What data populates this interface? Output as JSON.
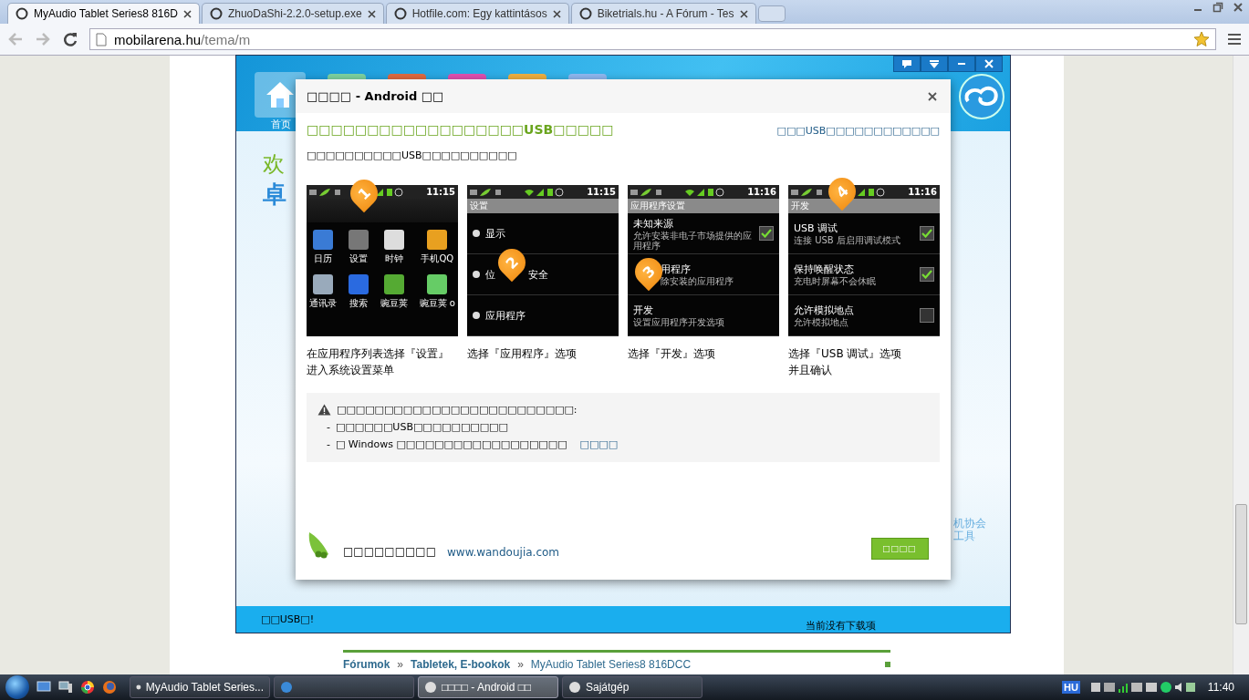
{
  "browser": {
    "tabs": [
      {
        "title": "MyAudio Tablet Series8 816D",
        "selected": true
      },
      {
        "title": "ZhuoDaShi-2.2.0-setup.exe",
        "selected": false
      },
      {
        "title": "Hotfile.com: Egy kattintásos",
        "selected": false
      },
      {
        "title": "Biketrials.hu - A Fórum - Tes",
        "selected": false
      }
    ],
    "address": {
      "host": "mobilarena.hu",
      "path": "/tema/m"
    }
  },
  "page": {
    "breadcrumb": [
      {
        "label": "Fórumok",
        "kind": "link"
      },
      {
        "label": "»",
        "kind": "sep"
      },
      {
        "label": "Tabletek, E-bookok",
        "kind": "link"
      },
      {
        "label": "»",
        "kind": "sep"
      },
      {
        "label": "MyAudio Tablet Series8 816DCC",
        "kind": "current"
      }
    ]
  },
  "app": {
    "home_label": "首页",
    "welcome": "欢",
    "welcome_sub": "卓",
    "side_lines": [
      "机协会",
      "工具"
    ],
    "status_left": "□□USB□!",
    "status_right": "当前没有下载项"
  },
  "dialog": {
    "title": "□□□□ - Android □□",
    "headline": "□□□□□□□□□□□□□□□□□□USB□□□□□",
    "help_link": "□□□USB□□□□□□□□□□□□",
    "subtitle": "□□□□□□□□□□USB□□□□□□□□□□",
    "steps": [
      {
        "kind": "home",
        "badge": "1",
        "time": "11:15",
        "apps": [
          "日历",
          "设置",
          "时钟",
          "手机QQ",
          "通讯录",
          "搜索",
          "豌豆荚",
          "豌豆荚 o"
        ],
        "caption": [
          "在应用程序列表选择『设置』",
          "进入系统设置菜单"
        ]
      },
      {
        "kind": "list",
        "badge": "2",
        "time": "11:15",
        "header": "设置",
        "items": [
          {
            "title": "显示"
          },
          {
            "title": "位",
            "title_after": "安全"
          },
          {
            "title": "应用程序"
          }
        ],
        "caption": [
          "选择『应用程序』选项"
        ]
      },
      {
        "kind": "list",
        "badge": "3",
        "time": "11:16",
        "header": "应用程序设置",
        "items": [
          {
            "title": "未知来源",
            "subtitle": "允许安装非电子市场提供的应用程序",
            "checked": true
          },
          {
            "title": "用程序",
            "subtitle": "除安装的应用程序"
          },
          {
            "title": "开发",
            "subtitle": "设置应用程序开发选项"
          }
        ],
        "caption": [
          "选择『开发』选项"
        ]
      },
      {
        "kind": "list",
        "badge": "4",
        "time": "11:16",
        "header": "开发",
        "items": [
          {
            "title": "USB 调试",
            "subtitle": "连接 USB 后启用调试模式",
            "checked": true
          },
          {
            "title": "保持唤醒状态",
            "subtitle": "充电时屏幕不会休眠",
            "checked": true
          },
          {
            "title": "允许模拟地点",
            "subtitle": "允许模拟地点",
            "checked": false
          }
        ],
        "caption": [
          "选择『USB 调试』选项",
          "并且确认"
        ]
      }
    ],
    "notice": {
      "heading": "□□□□□□□□□□□□□□□□□□□□□□□□□:",
      "bullets": [
        {
          "dash": "-",
          "text": "□□□□□□USB□□□□□□□□□□"
        },
        {
          "dash": "-",
          "text": "□ Windows □□□□□□□□□□□□□□□□□□",
          "link": "□□□□"
        }
      ]
    },
    "footer": {
      "text": "□□□□□□□□□",
      "link": "www.wandoujia.com",
      "button": "□□□□"
    }
  },
  "taskbar": {
    "tasks": [
      {
        "label": "MyAudio Tablet Series...",
        "selected": false
      },
      {
        "selected": false
      },
      {
        "label": "□□□□ - Android □□",
        "selected": true
      },
      {
        "label": "Sajátgép",
        "selected": false
      }
    ],
    "language": "HU",
    "clock": "11:40"
  }
}
